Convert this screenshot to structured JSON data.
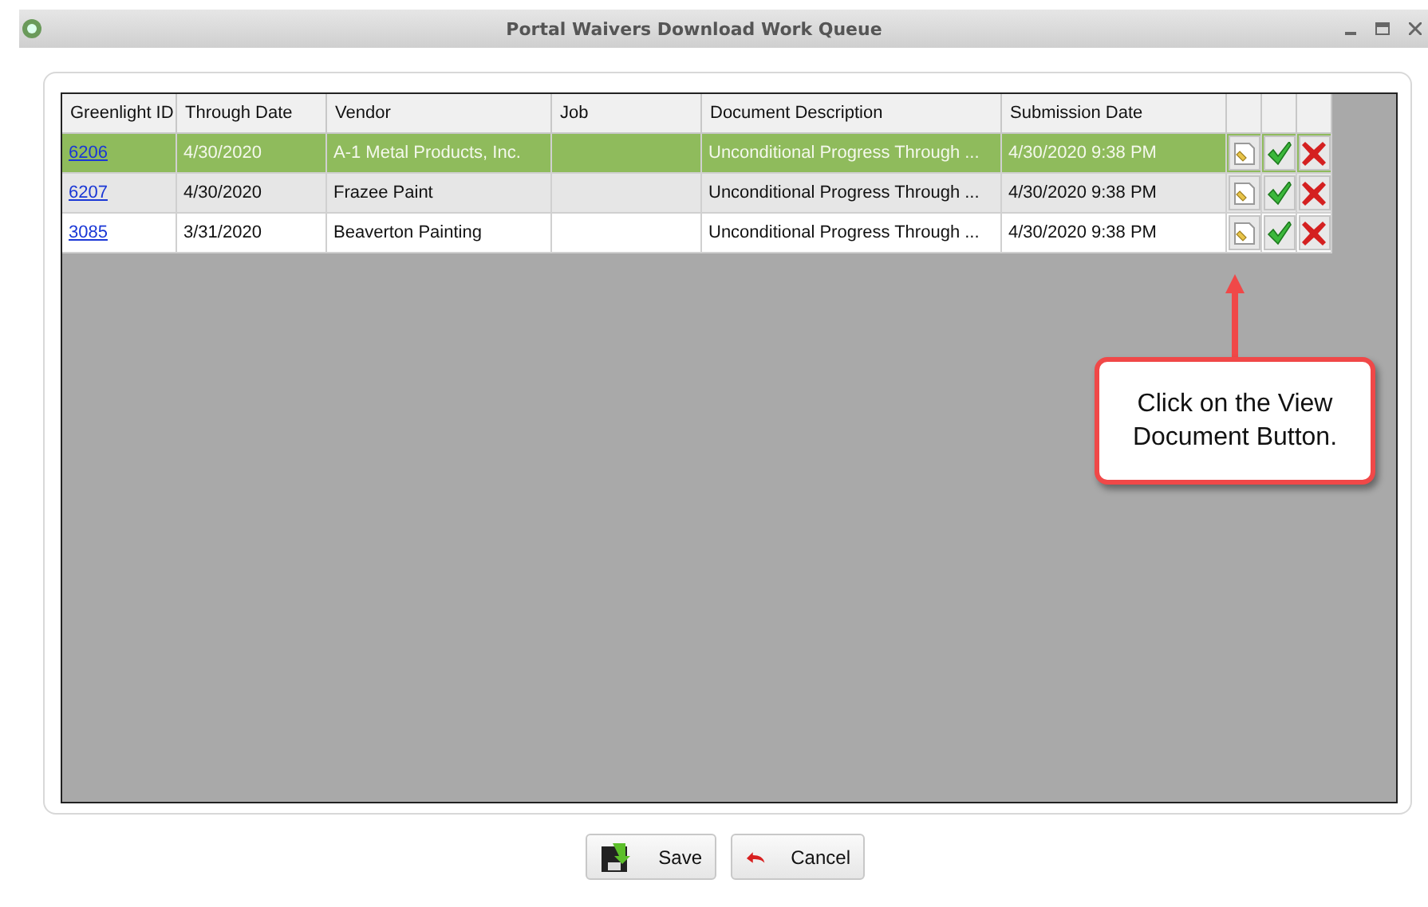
{
  "window": {
    "title": "Portal Waivers Download Work Queue"
  },
  "table": {
    "columns": [
      "Greenlight ID",
      "Through Date",
      "Vendor",
      "Job",
      "Document Description",
      "Submission Date"
    ],
    "rows": [
      {
        "selected": true,
        "id": "6206",
        "through_date": "4/30/2020",
        "vendor": "A-1 Metal Products, Inc.",
        "job": "",
        "description": "Unconditional Progress Through ...",
        "submission_date": "4/30/2020 9:38 PM"
      },
      {
        "selected": false,
        "id": "6207",
        "through_date": "4/30/2020",
        "vendor": "Frazee Paint",
        "job": "",
        "description": "Unconditional Progress Through ...",
        "submission_date": "4/30/2020 9:38 PM"
      },
      {
        "selected": false,
        "id": "3085",
        "through_date": "3/31/2020",
        "vendor": "Beaverton Painting",
        "job": "",
        "description": "Unconditional Progress Through ...",
        "submission_date": "4/30/2020 9:38 PM"
      }
    ]
  },
  "callout": {
    "text": "Click on the View Document Button."
  },
  "buttons": [
    {
      "kind": "save",
      "label": "Save"
    },
    {
      "kind": "cancel",
      "label": "Cancel"
    }
  ]
}
